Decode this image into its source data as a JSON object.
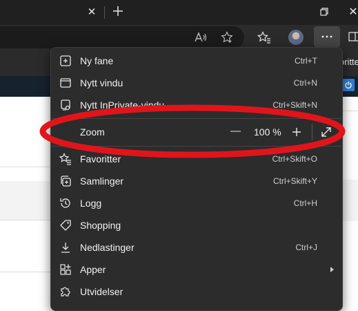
{
  "tab": {
    "close_glyph": "✕",
    "newtab_glyph": "+"
  },
  "extension_label": "oritte",
  "menu": {
    "items": [
      {
        "label": "Ny fane",
        "shortcut": "Ctrl+T",
        "icon": "new-tab-icon"
      },
      {
        "label": "Nytt vindu",
        "shortcut": "Ctrl+N",
        "icon": "new-window-icon"
      },
      {
        "label": "Nytt InPrivate-vindu",
        "shortcut": "Ctrl+Skift+N",
        "icon": "inprivate-icon"
      }
    ],
    "zoom": {
      "label": "Zoom",
      "minus": "—",
      "value": "100 %",
      "plus": "+"
    },
    "items2": [
      {
        "label": "Favoritter",
        "shortcut": "Ctrl+Skift+O",
        "icon": "favorites-icon"
      },
      {
        "label": "Samlinger",
        "shortcut": "Ctrl+Skift+Y",
        "icon": "collections-icon"
      },
      {
        "label": "Logg",
        "shortcut": "Ctrl+H",
        "icon": "history-icon"
      },
      {
        "label": "Shopping",
        "shortcut": "",
        "icon": "shopping-tag-icon"
      },
      {
        "label": "Nedlastinger",
        "shortcut": "Ctrl+J",
        "icon": "downloads-icon"
      },
      {
        "label": "Apper",
        "shortcut": "",
        "icon": "apps-icon"
      },
      {
        "label": "Utvidelser",
        "shortcut": "",
        "icon": "extensions-icon"
      }
    ]
  },
  "colors": {
    "annotation_red": "#e0151b",
    "menu_bg": "#2c2c2c",
    "title_bg": "#202020"
  }
}
